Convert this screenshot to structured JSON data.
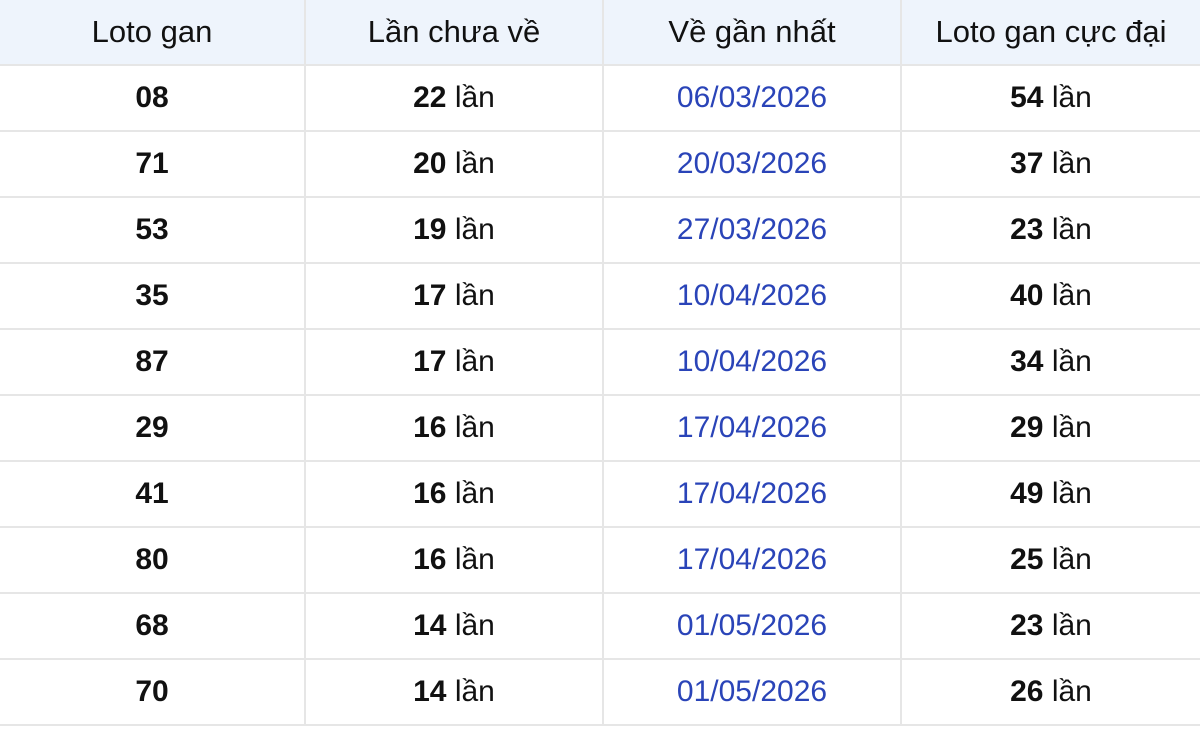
{
  "table": {
    "headers": [
      "Loto gan",
      "Lần chưa về",
      "Về gần nhất",
      "Loto gan cực đại"
    ],
    "unit": "lần",
    "rows": [
      {
        "loto": "08",
        "gan": "22",
        "last_date": "06/03/2026",
        "max_gan": "54"
      },
      {
        "loto": "71",
        "gan": "20",
        "last_date": "20/03/2026",
        "max_gan": "37"
      },
      {
        "loto": "53",
        "gan": "19",
        "last_date": "27/03/2026",
        "max_gan": "23"
      },
      {
        "loto": "35",
        "gan": "17",
        "last_date": "10/04/2026",
        "max_gan": "40"
      },
      {
        "loto": "87",
        "gan": "17",
        "last_date": "10/04/2026",
        "max_gan": "34"
      },
      {
        "loto": "29",
        "gan": "16",
        "last_date": "17/04/2026",
        "max_gan": "29"
      },
      {
        "loto": "41",
        "gan": "16",
        "last_date": "17/04/2026",
        "max_gan": "49"
      },
      {
        "loto": "80",
        "gan": "16",
        "last_date": "17/04/2026",
        "max_gan": "25"
      },
      {
        "loto": "68",
        "gan": "14",
        "last_date": "01/05/2026",
        "max_gan": "23"
      },
      {
        "loto": "70",
        "gan": "14",
        "last_date": "01/05/2026",
        "max_gan": "26"
      }
    ]
  },
  "colors": {
    "header_bg": "#eef4fc",
    "date_link": "#2a44b8",
    "grid": "#e6e6e6"
  }
}
